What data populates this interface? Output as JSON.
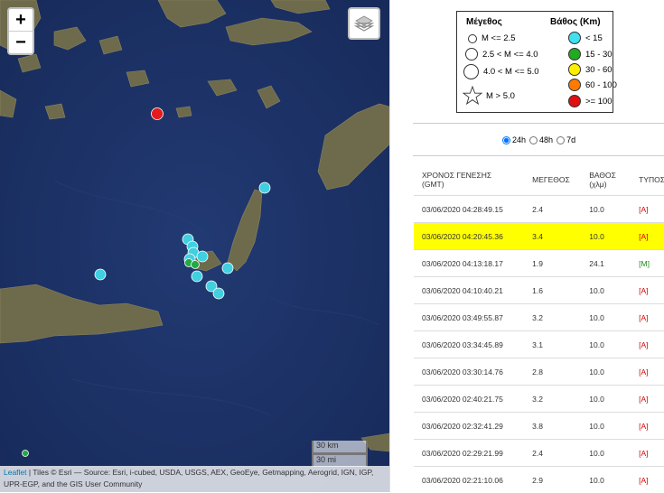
{
  "map": {
    "zoom_in": "+",
    "zoom_out": "−",
    "layers_icon": "layers-icon",
    "scale_km": "30 km",
    "scale_mi": "30 mi",
    "attribution_link": "Leaflet",
    "attribution_text": " | Tiles © Esri — Source: Esri, i-cubed, USDA, USGS, AEX, GeoEye, Getmapping, Aerogrid, IGN, IGP, UPR-EGP, and the GIS User Community",
    "colors": {
      "sea": "#1c2f63",
      "land": "#6d6a4f"
    },
    "markers": [
      {
        "label": "marker-deep-red",
        "color": "#e41a1c"
      },
      {
        "label": "marker-cyan",
        "color": "#40d0e0"
      },
      {
        "label": "marker-green",
        "color": "#22aa44"
      }
    ]
  },
  "legend": {
    "magnitude_title": "Μέγεθος",
    "depth_title": "Βάθος (Km)",
    "magnitude_items": [
      "M <= 2.5",
      "2.5 < M <= 4.0",
      "4.0 < M <= 5.0",
      "M > 5.0"
    ],
    "depth_items": [
      {
        "label": "< 15",
        "color": "#40e0f0"
      },
      {
        "label": "15 - 30",
        "color": "#22aa22"
      },
      {
        "label": "30 - 60",
        "color": "#ffee00"
      },
      {
        "label": "60 - 100",
        "color": "#ff7a00"
      },
      {
        "label": ">= 100",
        "color": "#e01010"
      }
    ]
  },
  "range": {
    "selected": "24h",
    "options": [
      "24h",
      "48h",
      "7d"
    ]
  },
  "table": {
    "headers": {
      "time_line1": "ΧΡΟΝΟΣ ΓΕΝΕΣΗΣ",
      "time_line2": "(GMT)",
      "magnitude": "ΜΕΓΕΘΟΣ",
      "depth_line1": "ΒΑΘΟΣ",
      "depth_line2": "(χλμ)",
      "type": "ΤΥΠΟΣ"
    },
    "rows": [
      {
        "time": "03/06/2020 04:28:49.15",
        "mag": "2.4",
        "depth": "10.0",
        "type": "[A]"
      },
      {
        "time": "03/06/2020 04:20:45.36",
        "mag": "3.4",
        "depth": "10.0",
        "type": "[A]"
      },
      {
        "time": "03/06/2020 04:13:18.17",
        "mag": "1.9",
        "depth": "24.1",
        "type": "[M]"
      },
      {
        "time": "03/06/2020 04:10:40.21",
        "mag": "1.6",
        "depth": "10.0",
        "type": "[A]"
      },
      {
        "time": "03/06/2020 03:49:55.87",
        "mag": "3.2",
        "depth": "10.0",
        "type": "[A]"
      },
      {
        "time": "03/06/2020 03:34:45.89",
        "mag": "3.1",
        "depth": "10.0",
        "type": "[A]"
      },
      {
        "time": "03/06/2020 03:30:14.76",
        "mag": "2.8",
        "depth": "10.0",
        "type": "[A]"
      },
      {
        "time": "03/06/2020 02:40:21.75",
        "mag": "3.2",
        "depth": "10.0",
        "type": "[A]"
      },
      {
        "time": "03/06/2020 02:32:41.29",
        "mag": "3.8",
        "depth": "10.0",
        "type": "[A]"
      },
      {
        "time": "03/06/2020 02:29:21.99",
        "mag": "2.4",
        "depth": "10.0",
        "type": "[A]"
      },
      {
        "time": "03/06/2020 02:21:10.06",
        "mag": "2.9",
        "depth": "10.0",
        "type": "[A]"
      }
    ]
  }
}
